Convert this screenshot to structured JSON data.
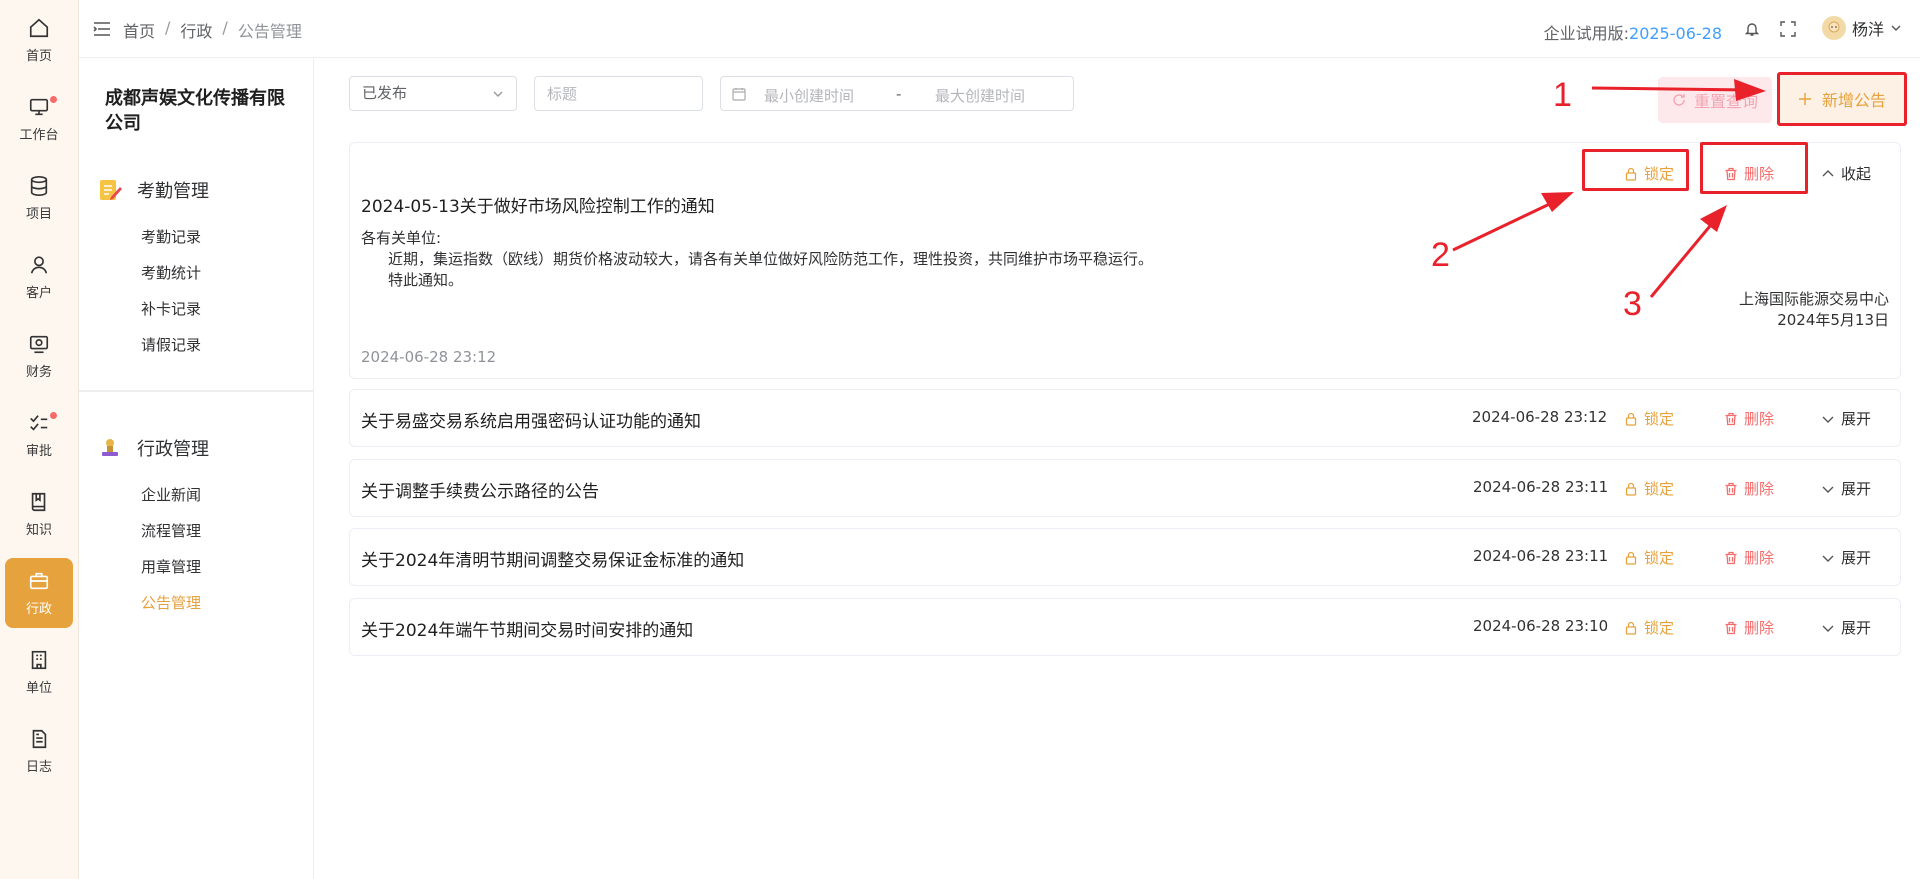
{
  "rail": {
    "items": [
      {
        "label": "首页",
        "icon": "home-icon"
      },
      {
        "label": "工作台",
        "icon": "monitor-icon",
        "dot": true
      },
      {
        "label": "项目",
        "icon": "database-icon"
      },
      {
        "label": "客户",
        "icon": "user-icon"
      },
      {
        "label": "财务",
        "icon": "finance-icon"
      },
      {
        "label": "审批",
        "icon": "approval-icon",
        "dot": true
      },
      {
        "label": "知识",
        "icon": "book-icon"
      },
      {
        "label": "行政",
        "icon": "briefcase-icon",
        "active": true
      },
      {
        "label": "单位",
        "icon": "building-icon"
      },
      {
        "label": "日志",
        "icon": "log-icon"
      }
    ]
  },
  "header": {
    "breadcrumb": [
      "首页",
      "行政",
      "公告管理"
    ],
    "trial_label": "企业试用版:",
    "trial_date": "2025-06-28",
    "user_name": "杨洋"
  },
  "subnav": {
    "company": "成都声娱文化传播有限公司",
    "groups": [
      {
        "title": "考勤管理",
        "items": [
          "考勤记录",
          "考勤统计",
          "补卡记录",
          "请假记录"
        ]
      },
      {
        "title": "行政管理",
        "items": [
          "企业新闻",
          "流程管理",
          "用章管理",
          "公告管理"
        ]
      }
    ]
  },
  "filters": {
    "status_value": "已发布",
    "title_placeholder": "标题",
    "start_placeholder": "最小创建时间",
    "range_sep": "-",
    "end_placeholder": "最大创建时间",
    "reset_label": "重置查询",
    "add_label": "新增公告"
  },
  "actions": {
    "lock_label": "锁定",
    "delete_label": "删除",
    "expand_label": "展开",
    "collapse_label": "收起"
  },
  "expanded": {
    "title": "2024-05-13关于做好市场风险控制工作的通知",
    "greeting": "各有关单位:",
    "line1": "近期，集运指数（欧线）期货价格波动较大，请各有关单位做好风险防范工作，理性投资，共同维护市场平稳运行。",
    "line2": "特此通知。",
    "signer": "上海国际能源交易中心",
    "sign_date": "2024年5月13日",
    "created": "2024-06-28 23:12"
  },
  "notices": [
    {
      "title": "关于易盛交易系统启用强密码认证功能的通知",
      "time": "2024-06-28 23:12"
    },
    {
      "title": "关于调整手续费公示路径的公告",
      "time": "2024-06-28 23:11"
    },
    {
      "title": "关于2024年清明节期间调整交易保证金标准的通知",
      "time": "2024-06-28 23:11"
    },
    {
      "title": "关于2024年端午节期间交易时间安排的通知",
      "time": "2024-06-28 23:10"
    }
  ],
  "annotations": {
    "n1": "1",
    "n2": "2",
    "n3": "3"
  },
  "colors": {
    "accent": "#e6a23c",
    "danger": "#f56c6c",
    "link": "#409eff",
    "annotation": "#e8212b"
  }
}
